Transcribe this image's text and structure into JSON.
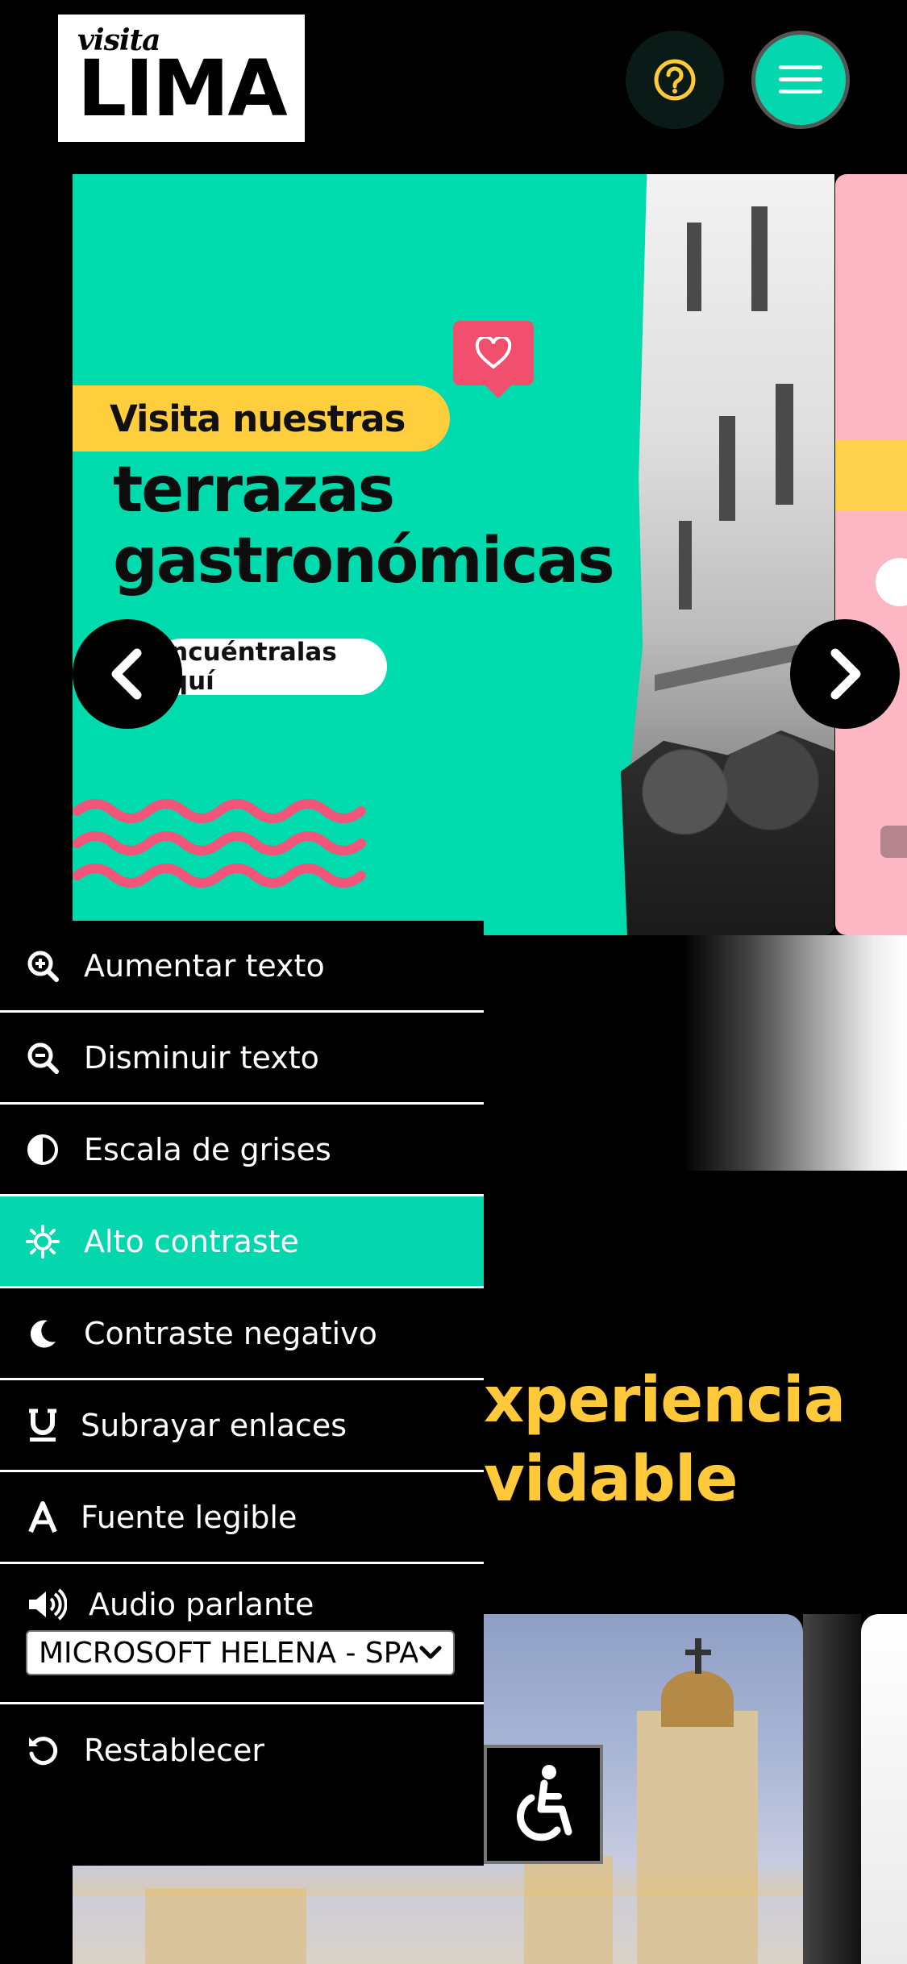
{
  "header": {
    "logo_small": "visita",
    "logo_big": "LIMA",
    "help_icon": "question-circle-icon",
    "menu_icon": "hamburger-icon"
  },
  "slider": {
    "slide": {
      "tag": "Visita nuestras",
      "title_line1": "terrazas",
      "title_line2": "gastronómicas",
      "cta": "Encuéntralas aquí"
    },
    "prev_icon": "chevron-left-icon",
    "next_icon": "chevron-right-icon"
  },
  "background_heading": {
    "line1": "xperiencia",
    "line2": "vidable"
  },
  "accessibility_panel": {
    "items": [
      {
        "label": "Aumentar texto",
        "icon": "zoom-in-icon"
      },
      {
        "label": "Disminuir texto",
        "icon": "zoom-out-icon"
      },
      {
        "label": "Escala de grises",
        "icon": "half-circle-icon"
      },
      {
        "label": "Alto contraste",
        "icon": "sun-icon",
        "active": true
      },
      {
        "label": "Contraste negativo",
        "icon": "moon-icon"
      },
      {
        "label": "Subrayar enlaces",
        "icon": "underline-icon"
      },
      {
        "label": "Fuente legible",
        "icon": "font-icon"
      }
    ],
    "audio": {
      "label": "Audio parlante",
      "icon": "speaker-icon",
      "voice_selected": "MICROSOFT HELENA - SPANISH (SPAIN)"
    },
    "reset": {
      "label": "Restablecer",
      "icon": "reset-icon"
    },
    "toggle_icon": "wheelchair-icon"
  },
  "colors": {
    "accent": "#04d6ad",
    "yellow": "#ffc93a",
    "pink": "#f24f6e",
    "background": "#000000"
  }
}
